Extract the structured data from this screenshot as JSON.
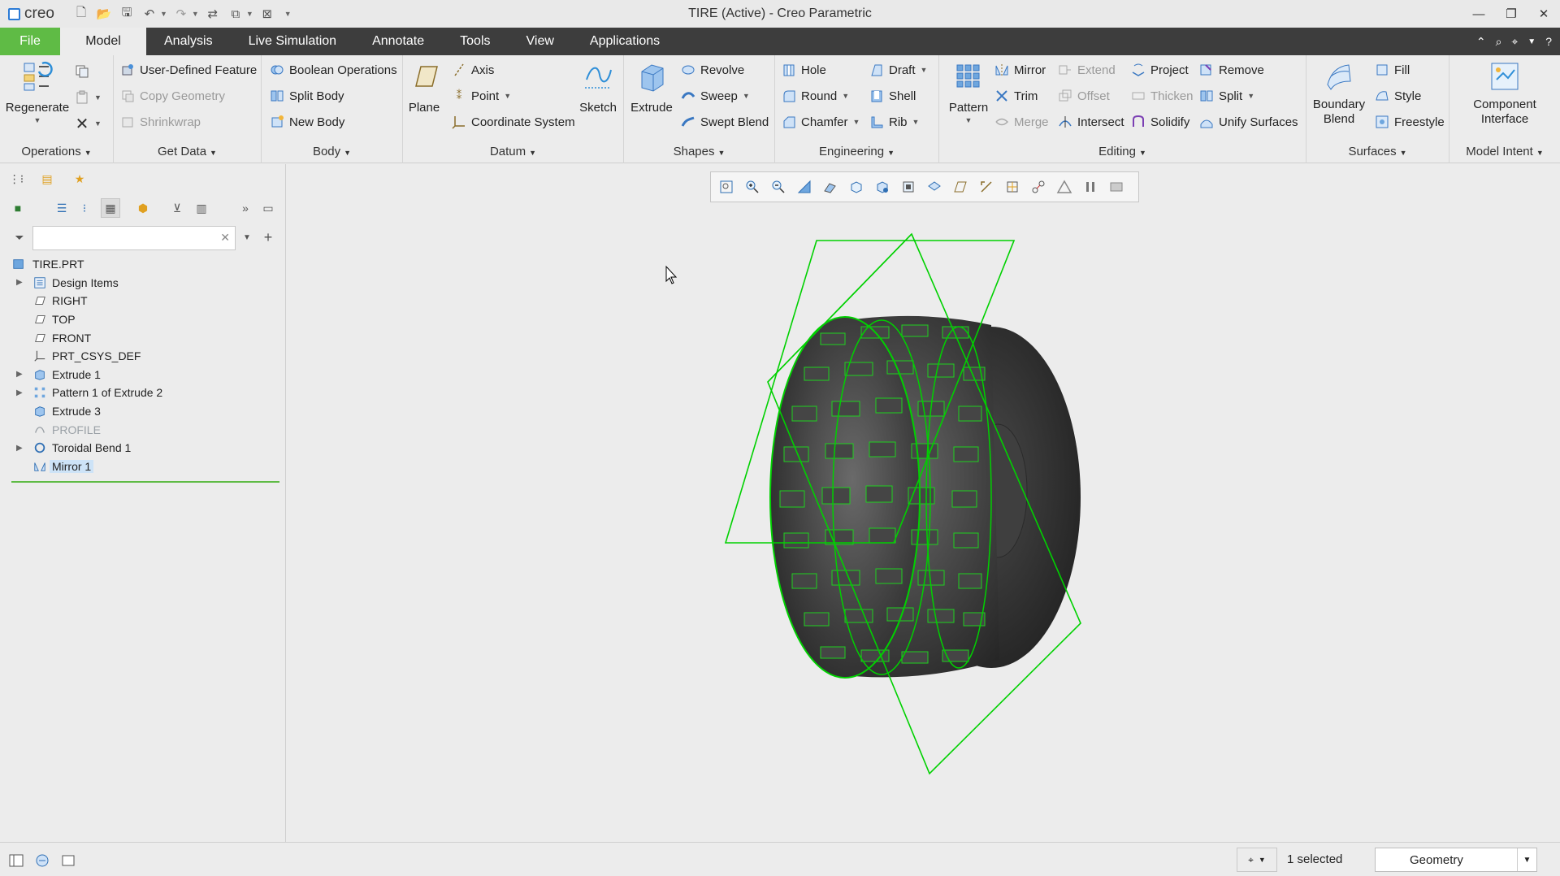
{
  "app": {
    "logo_text": "creo",
    "window_title": "TIRE (Active) - Creo Parametric"
  },
  "menu": {
    "tabs": [
      "File",
      "Model",
      "Analysis",
      "Live Simulation",
      "Annotate",
      "Tools",
      "View",
      "Applications"
    ],
    "active": "Model"
  },
  "ribbon": {
    "operations": {
      "regenerate": "Regenerate",
      "title": "Operations"
    },
    "get_data": {
      "user_defined_feature": "User-Defined Feature",
      "copy_geometry": "Copy Geometry",
      "shrinkwrap": "Shrinkwrap",
      "title": "Get Data"
    },
    "body": {
      "boolean_operations": "Boolean Operations",
      "split_body": "Split Body",
      "new_body": "New Body",
      "title": "Body"
    },
    "datum": {
      "plane": "Plane",
      "axis": "Axis",
      "point": "Point",
      "coordinate_system": "Coordinate System",
      "sketch": "Sketch",
      "title": "Datum"
    },
    "shapes": {
      "extrude": "Extrude",
      "revolve": "Revolve",
      "sweep": "Sweep",
      "swept_blend": "Swept Blend",
      "title": "Shapes"
    },
    "engineering": {
      "hole": "Hole",
      "round": "Round",
      "chamfer": "Chamfer",
      "draft": "Draft",
      "shell": "Shell",
      "rib": "Rib",
      "title": "Engineering"
    },
    "editing": {
      "pattern": "Pattern",
      "mirror": "Mirror",
      "trim": "Trim",
      "merge": "Merge",
      "extend": "Extend",
      "offset": "Offset",
      "intersect": "Intersect",
      "project": "Project",
      "thicken": "Thicken",
      "solidify": "Solidify",
      "remove": "Remove",
      "split": "Split",
      "unify_surfaces": "Unify Surfaces",
      "title": "Editing"
    },
    "surfaces": {
      "boundary_blend_1": "Boundary",
      "boundary_blend_2": "Blend",
      "fill": "Fill",
      "style": "Style",
      "freestyle": "Freestyle",
      "title": "Surfaces"
    },
    "model_intent": {
      "component_interface_1": "Component",
      "component_interface_2": "Interface",
      "title": "Model Intent"
    }
  },
  "model_tree": {
    "search_placeholder": "",
    "items": [
      {
        "label": "TIRE.PRT"
      },
      {
        "label": "Design Items"
      },
      {
        "label": "RIGHT"
      },
      {
        "label": "TOP"
      },
      {
        "label": "FRONT"
      },
      {
        "label": "PRT_CSYS_DEF"
      },
      {
        "label": "Extrude 1"
      },
      {
        "label": "Pattern 1 of Extrude 2"
      },
      {
        "label": "Extrude 3"
      },
      {
        "label": "PROFILE"
      },
      {
        "label": "Toroidal Bend 1"
      },
      {
        "label": "Mirror 1"
      }
    ]
  },
  "status": {
    "selected": "1 selected",
    "filter": "Geometry"
  },
  "colors": {
    "accent_green": "#5fbb45",
    "menubar": "#3d3d3d",
    "datum_green": "#00d100"
  }
}
